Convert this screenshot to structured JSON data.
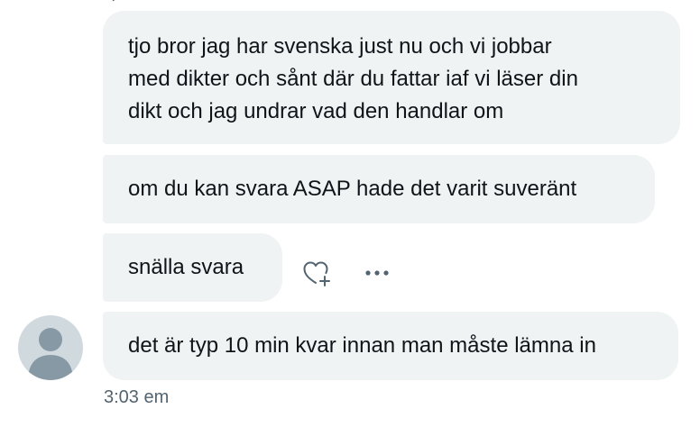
{
  "conversation": {
    "messages": [
      {
        "lines": [
          "tjo bror jag har svenska just nu och vi jobbar",
          "med dikter och sånt där du fattar iaf vi läser din",
          "dikt och jag undrar vad den handlar om"
        ]
      },
      {
        "lines": [
          "om du kan svara ASAP hade det varit suveränt"
        ]
      },
      {
        "lines": [
          "snälla svara"
        ]
      },
      {
        "lines": [
          "det är typ 10 min kvar innan man måste lämna in"
        ]
      }
    ],
    "timestamp": "3:03 em"
  },
  "actions": {
    "react_icon": "heart-plus-icon",
    "more_icon": "more-dots-icon"
  },
  "colors": {
    "bubble_bg": "#eff3f4",
    "text": "#0f1419",
    "secondary_text": "#536471",
    "avatar_bg": "#cfd9de",
    "avatar_fg": "#8899a6"
  }
}
